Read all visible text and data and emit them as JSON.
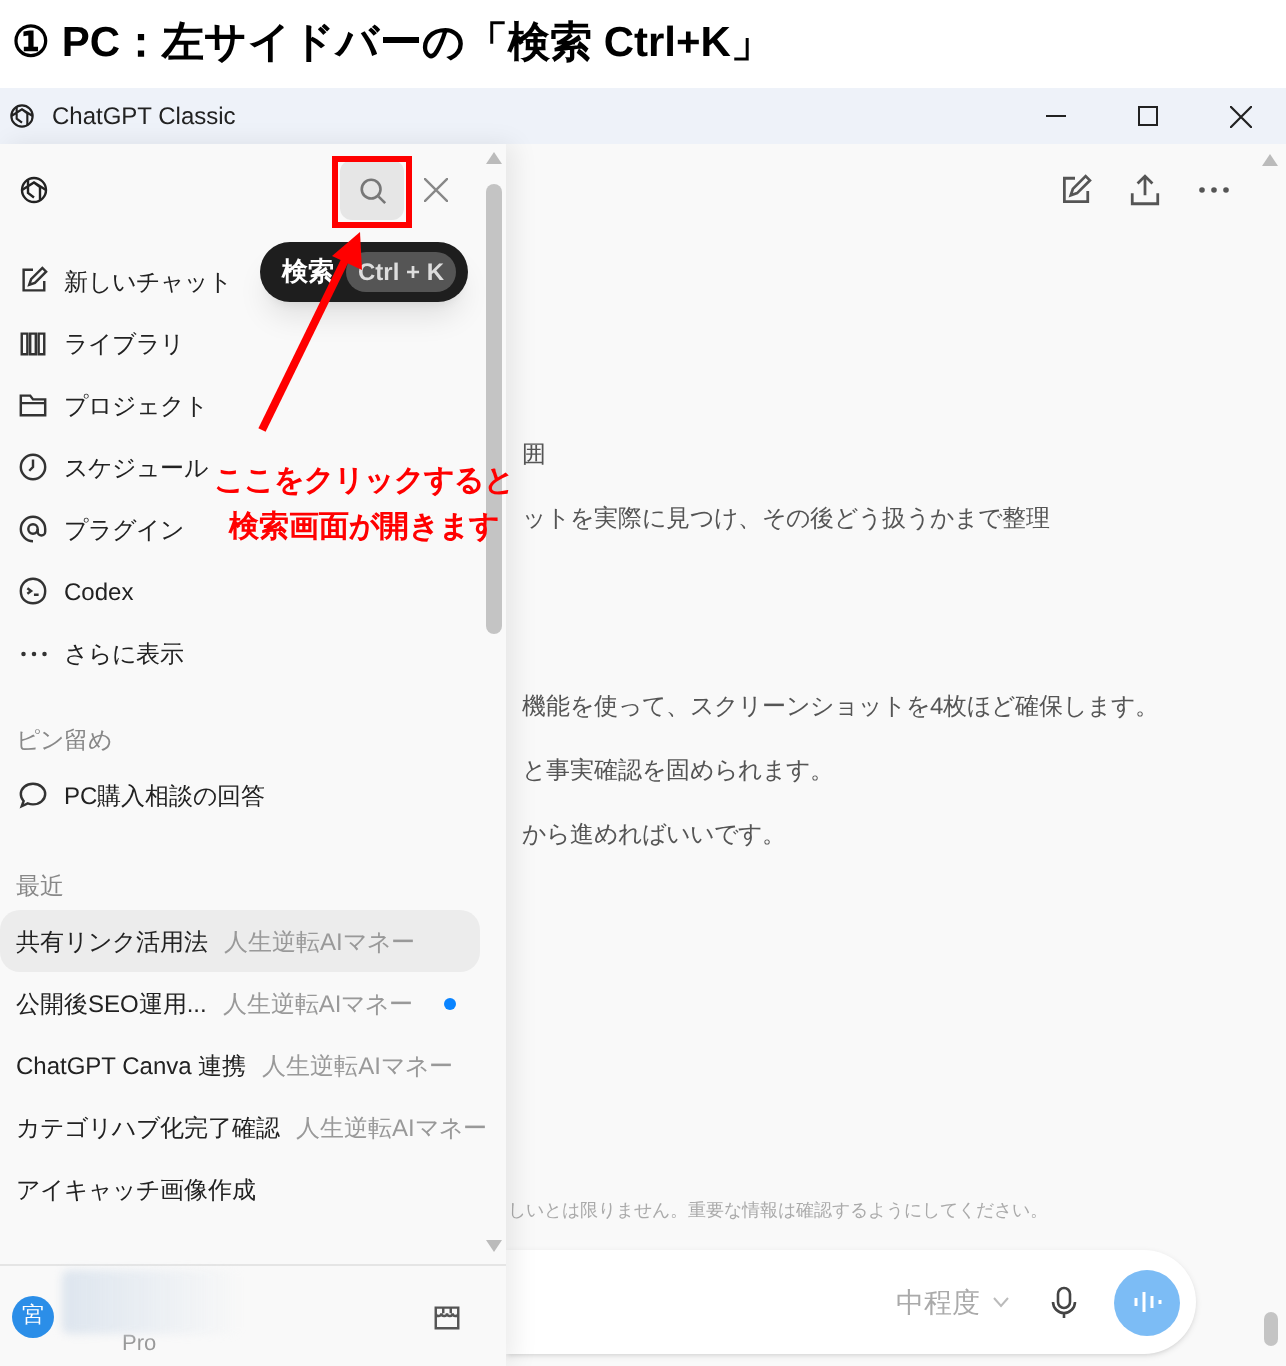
{
  "heading": "① PC：左サイドバーの「検索 Ctrl+K」",
  "window": {
    "title": "ChatGPT Classic"
  },
  "sidebar": {
    "nav": [
      {
        "label": "新しいチャット"
      },
      {
        "label": "ライブラリ"
      },
      {
        "label": "プロジェクト"
      },
      {
        "label": "スケジュール"
      },
      {
        "label": "プラグイン"
      },
      {
        "label": "Codex"
      },
      {
        "label": "さらに表示"
      }
    ],
    "pinned": {
      "heading": "ピン留め",
      "items": [
        {
          "title": "PC購入相談の回答"
        }
      ]
    },
    "recent": {
      "heading": "最近",
      "items": [
        {
          "title": "共有リンク活用法",
          "project": "人生逆転AIマネー",
          "selected": true,
          "unread": false
        },
        {
          "title": "公開後SEO運用...",
          "project": "人生逆転AIマネー",
          "selected": false,
          "unread": true
        },
        {
          "title": "ChatGPT Canva 連携",
          "project": "人生逆転AIマネー",
          "selected": false,
          "unread": false
        },
        {
          "title": "カテゴリハブ化完了確認",
          "project": "人生逆転AIマネー",
          "selected": false,
          "unread": false
        },
        {
          "title": "アイキャッチ画像作成",
          "selected": false,
          "unread": false
        }
      ]
    },
    "account": {
      "avatar": "宮",
      "plan": "Pro"
    }
  },
  "tooltip": {
    "label": "検索",
    "shortcut": "Ctrl + K"
  },
  "annotation": {
    "lines": [
      "ここをクリックすると",
      "検索画面が開きます"
    ]
  },
  "chat": {
    "lines": [
      {
        "text": "囲"
      },
      {
        "text": "ットを実際に見つけ、その後どう扱うかまで整理"
      },
      {
        "text": "機能を使って、スクリーンショットを4枚ほど確保します。"
      },
      {
        "text": "と事実確認を固められます。"
      },
      {
        "text": "から進めればいいです。"
      }
    ],
    "disclaimer": "しいとは限りません。重要な情報は確認するようにしてください。",
    "composer": {
      "model": "中程度"
    }
  }
}
